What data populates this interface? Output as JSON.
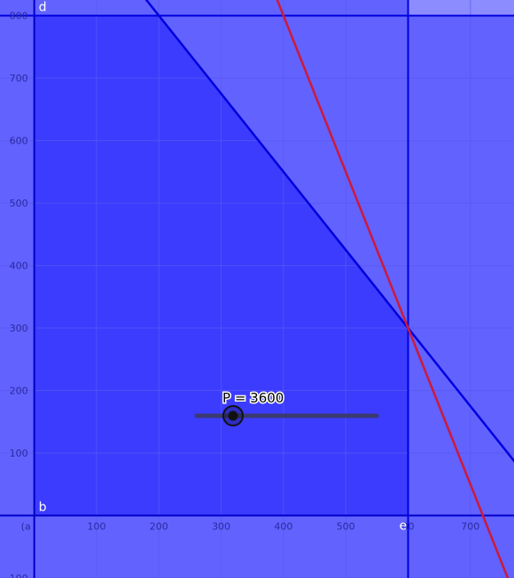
{
  "app": {
    "view": "graphics-view"
  },
  "colors": {
    "base_fill": "#6262ff",
    "top_right_fill": "#8c8cff",
    "feasible_fill": "#3c3cff",
    "blue_line": "#0000e0",
    "red_line": "#cc1a3a",
    "axis": "#0000c8",
    "grid": "#5858f0",
    "slider_track": "#3a3a70",
    "slider_knob": "#111111"
  },
  "axes": {
    "x_range": [
      -55,
      770
    ],
    "y_range": [
      -100,
      825
    ],
    "x_tick_values": [
      100,
      200,
      300,
      400,
      500,
      600,
      700
    ],
    "x_tick_labels": [
      "100",
      "200",
      "300",
      "400",
      "500",
      "00",
      "700"
    ],
    "y_tick_values": [
      100,
      200,
      300,
      400,
      500,
      600,
      700,
      800
    ],
    "y_tick_labels": [
      "100",
      "200",
      "300",
      "400",
      "500",
      "600",
      "700",
      "800"
    ],
    "y_bottom_label": "100",
    "origin_label": "(a",
    "grid": true
  },
  "constraints": {
    "blue_line": {
      "intercept": 1050,
      "slope": -1.25
    },
    "red_line": {
      "intercept": 1800,
      "slope": -2.5
    },
    "vertical_line_x": 600,
    "horizontal_line_y": 800
  },
  "line_labels": {
    "d": "d",
    "b": "b",
    "e": "e"
  },
  "slider": {
    "name": "P",
    "value": 3600,
    "text": "P = 3600"
  }
}
